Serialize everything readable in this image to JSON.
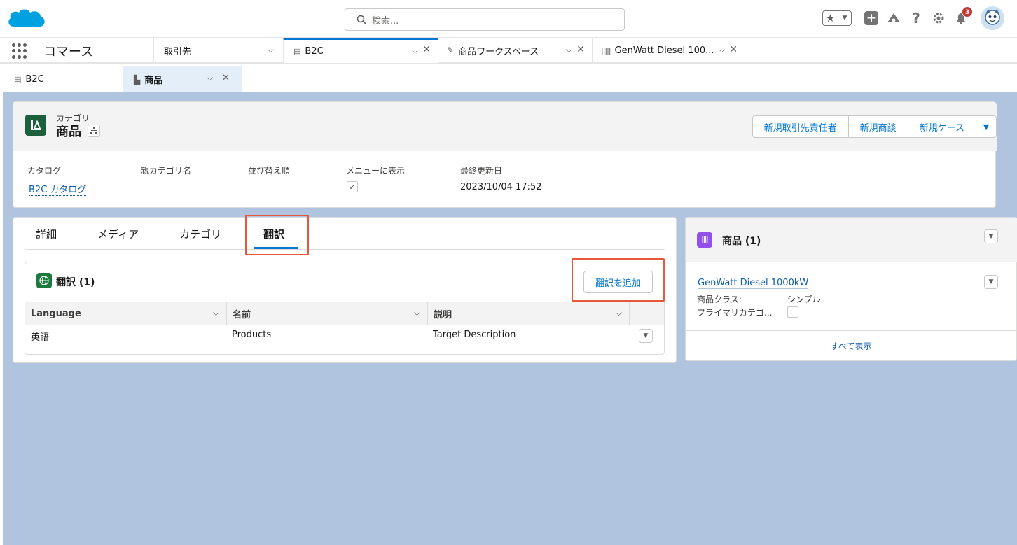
{
  "header": {
    "search_placeholder": "検索...",
    "notification_count": "3"
  },
  "nav": {
    "app_name": "コマース",
    "tabs": [
      {
        "label": "取引先"
      },
      {
        "label": "B2C"
      },
      {
        "label": "商品ワークスペース"
      },
      {
        "label": "GenWatt Diesel 100..."
      }
    ]
  },
  "subtabs": [
    {
      "label": "B2C"
    },
    {
      "label": "商品"
    }
  ],
  "record": {
    "object_label": "カテゴリ",
    "title": "商品",
    "actions": [
      "新規取引先責任者",
      "新規商談",
      "新規ケース"
    ],
    "fields": [
      {
        "label": "カタログ",
        "value": "B2C カタログ"
      },
      {
        "label": "親カテゴリ名",
        "value": ""
      },
      {
        "label": "並び替え順",
        "value": ""
      },
      {
        "label": "メニューに表示",
        "value": "✓"
      },
      {
        "label": "最終更新日",
        "value": "2023/10/04 17:52"
      }
    ]
  },
  "record_tabs": [
    "詳細",
    "メディア",
    "カテゴリ",
    "翻訳"
  ],
  "translations": {
    "title": "翻訳 (1)",
    "add_button": "翻訳を追加",
    "columns": [
      "Language",
      "名前",
      "説明"
    ],
    "rows": [
      [
        "英語",
        "Products",
        "Target Description"
      ]
    ]
  },
  "products_panel": {
    "title": "商品 (1)",
    "item_name": "GenWatt Diesel 1000kW",
    "fields": [
      {
        "label": "商品クラス:",
        "value": "シンプル"
      },
      {
        "label": "プライマリカテゴ...",
        "value": ""
      }
    ],
    "view_all": "すべて表示"
  }
}
